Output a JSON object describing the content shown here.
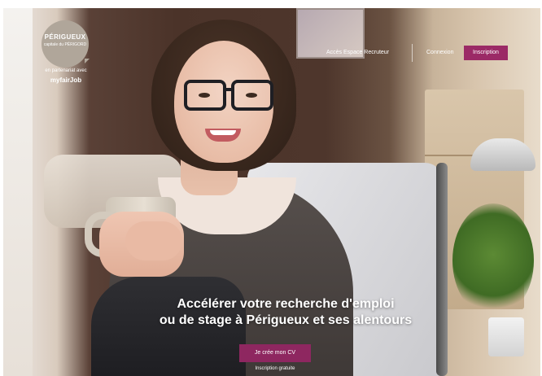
{
  "colors": {
    "accent": "#9b2a66",
    "cta": "#8e2760",
    "logo_bg": "#b0a69a"
  },
  "logo": {
    "name": "PÉRIGUEUX",
    "subtitle": "capitale du PÉRIGORD"
  },
  "partner_text": "en partenariat avec",
  "partner_brand": "myfairJob",
  "nav": {
    "recruiter": "Accès Espace Recruteur",
    "login": "Connexion",
    "signup": "Inscription"
  },
  "hero": {
    "line1": "Accélérer votre recherche d'emploi",
    "line2": "ou de stage à Périgueux et ses alentours",
    "cta_label": "Je crée mon CV",
    "cta_note": "Inscription gratuite"
  }
}
